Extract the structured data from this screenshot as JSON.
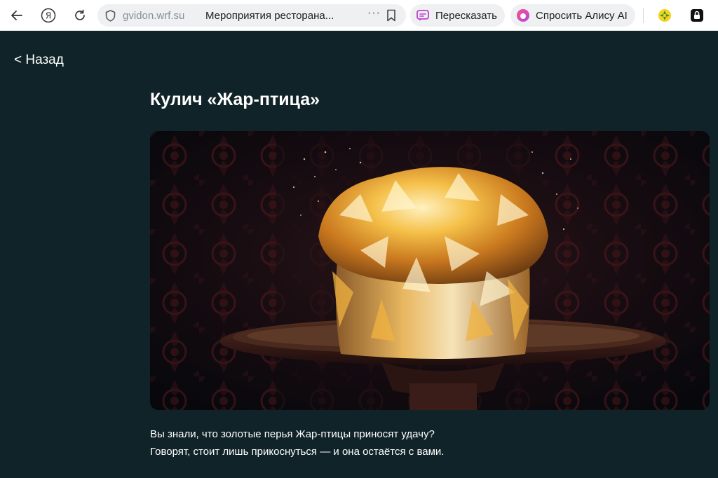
{
  "browser": {
    "url_host": "gvidon.wrf.su",
    "tab_title": "Мероприятия ресторана...",
    "more_label": "···",
    "summarize_label": "Пересказать",
    "alice_label": "Спросить Алису AI",
    "icons": [
      "back-arrow-icon",
      "yandex-icon",
      "reload-icon",
      "shield-icon",
      "bookmark-icon",
      "summarize-icon",
      "alice-icon",
      "extension-icon",
      "lock-icon"
    ],
    "colors": {
      "summarize_accent": "#c23fd0",
      "alice_accent": "#e0487a"
    }
  },
  "page": {
    "back_label": "< Назад",
    "title": "Кулич «Жар-птица»",
    "description": [
      "Вы знали, что золотые перья Жар-птицы приносят удачу?",
      "Говорят, стоит лишь прикоснуться — и она остаётся с вами."
    ],
    "colors": {
      "background": "#102328",
      "text": "#ffffff"
    }
  }
}
